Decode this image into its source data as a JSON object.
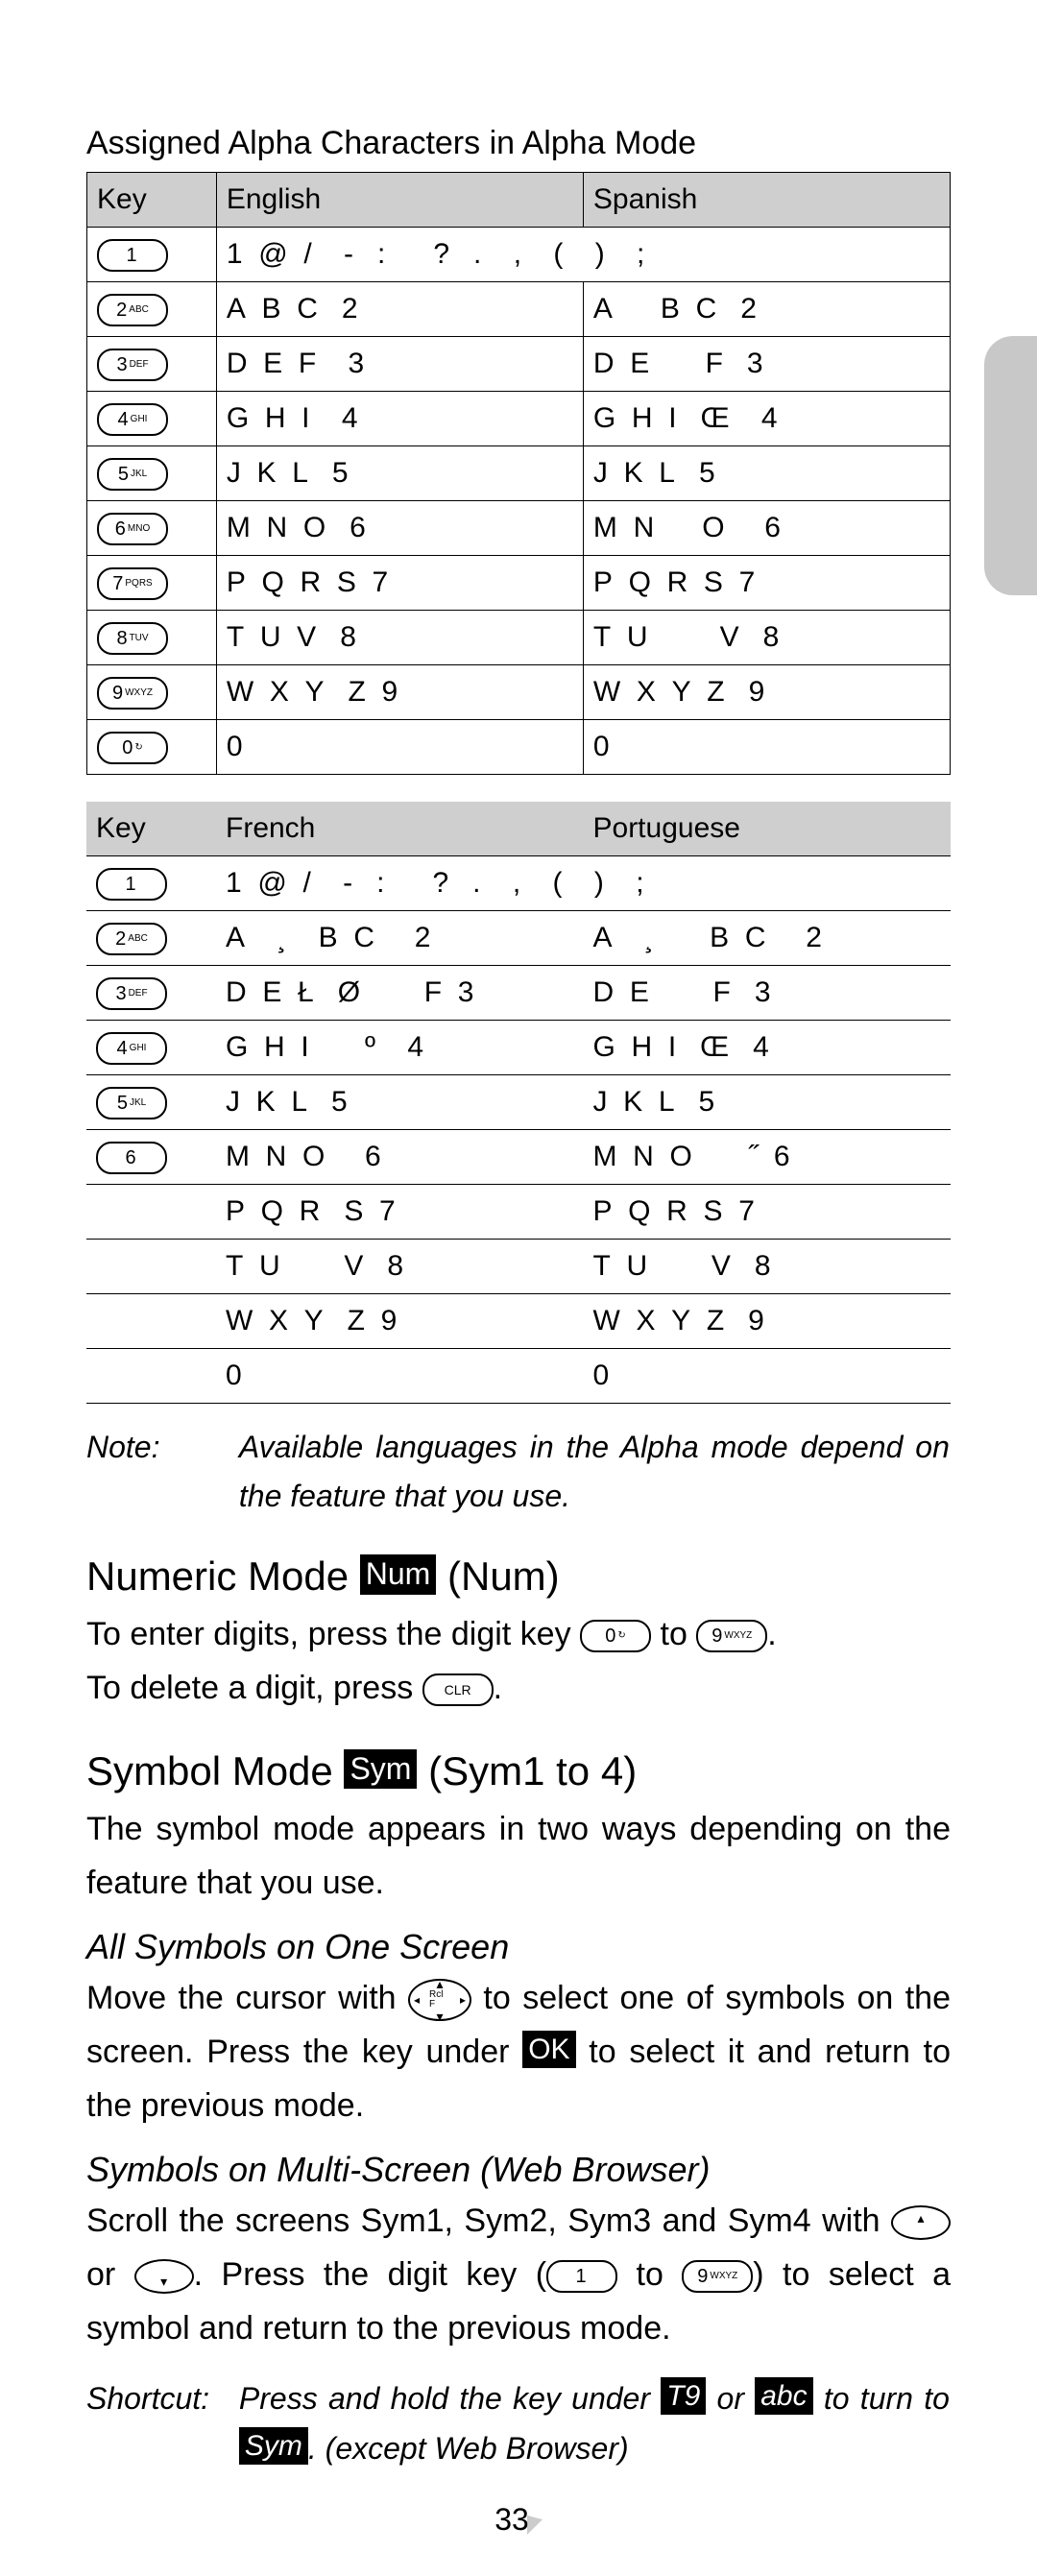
{
  "title": "Assigned Alpha Characters in Alpha Mode",
  "table1": {
    "headers": {
      "key": "Key",
      "lang1": "English",
      "lang2": "Spanish"
    },
    "rows": [
      {
        "key": {
          "d": "1",
          "s": ""
        },
        "c1": "1  @  /    -   :      ?   .    ,    (    )    ;",
        "c2": ""
      },
      {
        "key": {
          "d": "2",
          "s": "ABC"
        },
        "c1": "A  B  C   2",
        "c2": "A      B  C   2"
      },
      {
        "key": {
          "d": "3",
          "s": "DEF"
        },
        "c1": "D  E  F    3",
        "c2": "D  E       F   3"
      },
      {
        "key": {
          "d": "4",
          "s": "GHI"
        },
        "c1": "G  H  I    4",
        "c2": "G  H  I   Œ    4"
      },
      {
        "key": {
          "d": "5",
          "s": "JKL"
        },
        "c1": "J  K  L   5",
        "c2": "J  K  L   5"
      },
      {
        "key": {
          "d": "6",
          "s": "MNO"
        },
        "c1": "M  N  O   6",
        "c2": "M  N      O     6"
      },
      {
        "key": {
          "d": "7",
          "s": "PQRS"
        },
        "c1": "P  Q  R  S  7",
        "c2": "P  Q  R  S  7"
      },
      {
        "key": {
          "d": "8",
          "s": "TUV"
        },
        "c1": "T  U  V   8",
        "c2": "T  U         V   8"
      },
      {
        "key": {
          "d": "9",
          "s": "WXYZ"
        },
        "c1": "W  X  Y   Z  9",
        "c2": "W  X  Y  Z   9"
      },
      {
        "key": {
          "d": "0",
          "s": "↻"
        },
        "c1": "0",
        "c2": "0"
      }
    ]
  },
  "table2": {
    "headers": {
      "key": "Key",
      "lang1": "French",
      "lang2": "Portuguese"
    },
    "rows": [
      {
        "key": {
          "d": "1",
          "s": ""
        },
        "c1": "1  @  /    -   :      ?   .    ,    (    )    ;",
        "c2": ""
      },
      {
        "key": {
          "d": "2",
          "s": "ABC"
        },
        "c1": "A    ¸    B  C     2",
        "c2": "A    ¸       B  C     2"
      },
      {
        "key": {
          "d": "3",
          "s": "DEF"
        },
        "c1": "D  E  Ł   Ø        F  3",
        "c2": "D  E        F   3"
      },
      {
        "key": {
          "d": "4",
          "s": "GHI"
        },
        "c1": "G  H  I       º    4",
        "c2": "G  H  I   Œ   4"
      },
      {
        "key": {
          "d": "5",
          "s": "JKL"
        },
        "c1": "J  K  L   5",
        "c2": "J  K  L   5"
      },
      {
        "key": {
          "d": "6",
          "s": ""
        },
        "c1": "M  N  O     6",
        "c2": "M  N  O       ˝  6"
      },
      {
        "key": null,
        "c1": "P  Q  R   S  7",
        "c2": "P  Q  R  S  7"
      },
      {
        "key": null,
        "c1": "T  U        V   8",
        "c2": "T  U        V   8"
      },
      {
        "key": null,
        "c1": "W  X  Y   Z  9",
        "c2": "W  X  Y  Z   9"
      },
      {
        "key": null,
        "c1": "0",
        "c2": "0"
      }
    ]
  },
  "note": {
    "label": "Note:",
    "body": "Available languages in the Alpha mode depend on the feature that you use."
  },
  "numeric": {
    "heading_pre": "Numeric Mode  ",
    "badge": "Num",
    "heading_post": " (Num)",
    "line1_a": "To enter digits, press the digit key ",
    "line1_b": " to ",
    "line1_c": ".",
    "line2_a": "To delete a digit, press ",
    "line2_b": ".",
    "key0": {
      "d": "0",
      "s": "↻"
    },
    "key9": {
      "d": "9",
      "s": "WXYZ"
    },
    "keyclr": {
      "d": "",
      "s": "CLR"
    }
  },
  "symbol": {
    "heading_pre": "Symbol Mode  ",
    "badge": "Sym",
    "heading_post": " (Sym1 to 4)",
    "intro": "The symbol mode appears in two ways depending on the feature that you use.",
    "sub1": "All Symbols on One Screen",
    "p1_a": "Move the cursor with ",
    "p1_b": " to select one of symbols on the screen. Press the key under ",
    "ok": "OK",
    "p1_c": " to select it and return to the previous mode.",
    "navkey": {
      "d": "",
      "s": "Rcl  F"
    },
    "sub2": "Symbols on Multi-Screen (Web Browser)",
    "p2_a": "Scroll the screens Sym1, Sym2, Sym3 and Sym4 with ",
    "p2_b": " or ",
    "p2_c": ". Press the digit key (",
    "p2_d": " to ",
    "p2_e": ") to select a symbol and return to the previous mode.",
    "key1": {
      "d": "1",
      "s": ""
    },
    "key9": {
      "d": "9",
      "s": "WXYZ"
    }
  },
  "shortcut": {
    "label": "Shortcut:",
    "a": "Press and hold the key under ",
    "t9": "T9",
    "b": " or ",
    "abc": "abc",
    "c": " to turn to ",
    "sym": "Sym",
    "d": ". (except Web Browser)"
  },
  "pagenum": "33"
}
